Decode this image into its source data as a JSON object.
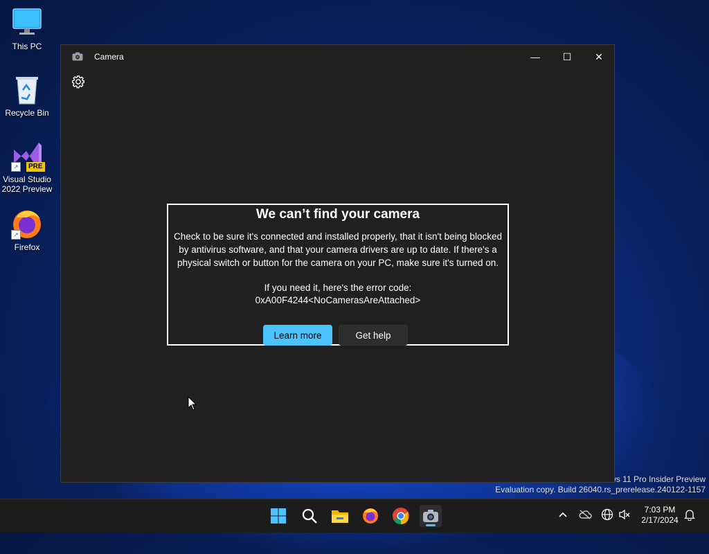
{
  "desktop": {
    "icons": [
      {
        "label": "This PC",
        "icon": "monitor-icon"
      },
      {
        "label": "Recycle Bin",
        "icon": "recycle-bin-icon"
      },
      {
        "label_line1": "Visual Studio",
        "label_line2": "2022 Preview",
        "badge": "PRE",
        "icon": "visual-studio-icon"
      },
      {
        "label": "Firefox",
        "icon": "firefox-icon"
      }
    ],
    "watermark_line1": "ws 11 Pro Insider Preview",
    "watermark_line2": "Evaluation copy. Build 26040.rs_prerelease.240122-1157"
  },
  "window": {
    "title": "Camera",
    "controls": {
      "minimize": "—",
      "maximize": "☐",
      "close": "✕"
    }
  },
  "dialog": {
    "title": "We can’t find your camera",
    "body_line1": "Check to be sure it's connected and installed properly, that it isn't being blocked",
    "body_line2": "by antivirus software, and that your camera drivers are up to date. If there's a",
    "body_line3": "physical switch or button for the camera on your PC, make sure it's turned on.",
    "error_intro": "If you need it, here's the error code:",
    "error_code": "0xA00F4244<NoCamerasAreAttached>",
    "learn_more": "Learn more",
    "get_help": "Get help"
  },
  "taskbar": {
    "apps": [
      "start-icon",
      "search-icon",
      "file-explorer-icon",
      "firefox-icon",
      "chrome-icon",
      "camera-icon"
    ],
    "time": "7:03 PM",
    "date": "2/17/2024"
  },
  "colors": {
    "accent": "#4cc2ff",
    "window_bg": "#202020",
    "taskbar_bg": "#1c1c1c"
  }
}
